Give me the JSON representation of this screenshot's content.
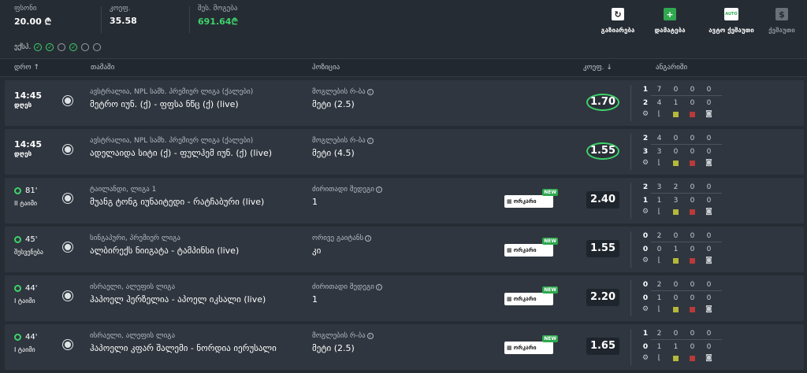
{
  "summary": {
    "stake_label": "ფსონი",
    "stake_value": "20.00 ₾",
    "odds_label": "კოეფ.",
    "odds_value": "35.58",
    "payout_label": "შეს. მოგება",
    "payout_value": "691.64₾"
  },
  "actions": [
    {
      "label": "გაზიარება",
      "icon": "↻",
      "bg": "#ffffff",
      "fg": "#222222"
    },
    {
      "label": "დამატება",
      "icon": "+",
      "bg": "#2fa84f",
      "fg": "#ffffff"
    },
    {
      "label": "ავტო ქეშაუთი",
      "icon": "AUTO",
      "bg": "#ffffff",
      "fg": "#2fa84f"
    },
    {
      "label": "ქეშაუთი",
      "icon": "$",
      "bg": "#6a7078",
      "fg": "#262c34"
    }
  ],
  "express": {
    "label": "ექსპ.",
    "dots": [
      "on",
      "on",
      "off",
      "on",
      "off",
      "off"
    ]
  },
  "header": {
    "date": "დრო ↑",
    "event": "თამაში",
    "position": "პოზიცია",
    "odds": "კოეფ. ↓",
    "stats": "ანგარიში"
  },
  "rows": [
    {
      "time": "14:45",
      "time_sub": "დღეს",
      "is_live": false,
      "league": "ავსტრალია, NPL სამხ. პრემიერ ლიგა (ქალები)",
      "teams": "მეტრო იუნ. (ქ) - ფფსა ნწც (ქ) (live)",
      "market": "მოგლების რ-ბა",
      "selection": "მეტი (2.5)",
      "odds": "1.70",
      "ring": true,
      "promo": false,
      "stats_top": [
        "1",
        "7",
        "0",
        "0",
        "0"
      ],
      "stats_bottom": [
        "2",
        "4",
        "1",
        "0",
        "0"
      ]
    },
    {
      "time": "14:45",
      "time_sub": "დღეს",
      "is_live": false,
      "league": "ავსტრალია, NPL სამხ. პრემიერ ლიგა (ქალები)",
      "teams": "ადელაიდა სიტი (ქ) - ფულჰემ იუნ. (ქ) (live)",
      "market": "მოგლების რ-ბა",
      "selection": "მეტი (4.5)",
      "odds": "1.55",
      "ring": true,
      "promo": false,
      "stats_top": [
        "2",
        "4",
        "0",
        "0",
        "0"
      ],
      "stats_bottom": [
        "3",
        "3",
        "0",
        "0",
        "0"
      ]
    },
    {
      "time": "81'",
      "time_sub": "II ტაიმი",
      "is_live": true,
      "league": "ტაილანდი, ლიგა 1",
      "teams": "მუანგ ტონგ იუნაიტედი - რატჩაბური (live)",
      "market": "ძირითადი შედეგი",
      "selection": "1",
      "odds": "2.40",
      "ring": false,
      "promo": true,
      "stats_top": [
        "2",
        "3",
        "2",
        "0",
        "0"
      ],
      "stats_bottom": [
        "1",
        "1",
        "3",
        "0",
        "0"
      ]
    },
    {
      "time": "45'",
      "time_sub": "შესვენება",
      "is_live": true,
      "league": "სინგაპური, პრემიერ ლიგა",
      "teams": "ალბირექს ნიიგატა - ტამპინსი (live)",
      "market": "ორივე გაიტანს",
      "selection": "კი",
      "odds": "1.55",
      "ring": false,
      "promo": true,
      "stats_top": [
        "0",
        "2",
        "0",
        "0",
        "0"
      ],
      "stats_bottom": [
        "0",
        "0",
        "1",
        "0",
        "0"
      ]
    },
    {
      "time": "44'",
      "time_sub": "I ტაიმი",
      "is_live": true,
      "league": "ისრაელი, ალეფის ლიგა",
      "teams": "ჰაპოელ ჰერზელია - აპოელ იკსალი (live)",
      "market": "ძირითადი შედეგი",
      "selection": "1",
      "odds": "2.20",
      "ring": false,
      "promo": true,
      "stats_top": [
        "0",
        "2",
        "0",
        "0",
        "0"
      ],
      "stats_bottom": [
        "0",
        "1",
        "0",
        "0",
        "0"
      ]
    },
    {
      "time": "44'",
      "time_sub": "I ტაიმი",
      "is_live": true,
      "league": "ისრაელი, ალეფის ლიგა",
      "teams": "ჰაპოელი კფარ შალემი - ნორდია იერუსალი",
      "market": "მოგლების რ-ბა",
      "selection": "მეტი (2.5)",
      "odds": "1.65",
      "ring": false,
      "promo": true,
      "stats_top": [
        "1",
        "2",
        "0",
        "0",
        "0"
      ],
      "stats_bottom": [
        "0",
        "1",
        "1",
        "0",
        "0"
      ]
    }
  ],
  "promo_label": "ორკარი",
  "promo_new": "NEW",
  "colors": {
    "accent": "#3fd36b",
    "yellow": "#b5b83a",
    "red": "#b83a3a"
  }
}
